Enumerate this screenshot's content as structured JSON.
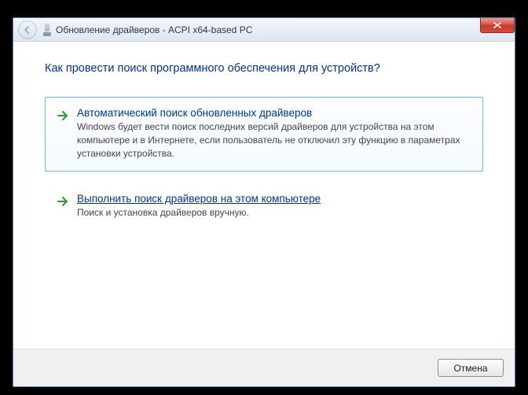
{
  "window": {
    "title": "Обновление драйверов - ACPI x64-based PC"
  },
  "heading": "Как провести поиск программного обеспечения для устройств?",
  "options": [
    {
      "title": "Автоматический поиск обновленных драйверов",
      "desc": "Windows будет вести поиск последних версий драйверов для устройства на этом компьютере и в Интернете, если пользователь не отключил эту функцию в параметрах установки устройства."
    },
    {
      "title": "Выполнить поиск драйверов на этом компьютере",
      "desc": "Поиск и установка драйверов вручную."
    }
  ],
  "buttons": {
    "cancel": "Отмена"
  }
}
